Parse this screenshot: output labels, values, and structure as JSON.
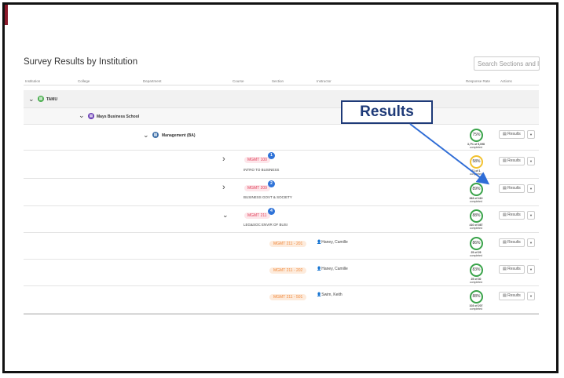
{
  "page": {
    "title": "Survey Results by Institution",
    "search_placeholder": "Search Sections and Insti"
  },
  "columns": {
    "institution": "Institution",
    "college": "College",
    "department": "Department",
    "course": "Course",
    "section": "Section",
    "instructor": "Instructor",
    "response_rate": "Response Rate",
    "actions": "Actions"
  },
  "tree": {
    "institution": "TAMU",
    "college": "Mays Business School",
    "department": "Management (BA)"
  },
  "rates": {
    "mgmt": {
      "pct": "75%",
      "count": "3,7% of 5,098",
      "sub": "completed",
      "value": 0.75
    },
    "c100": {
      "pct": "58%",
      "count": "71 of 1",
      "sub": "completed",
      "value": 0.58
    },
    "c209": {
      "pct": "89%",
      "count": "363 of 410",
      "sub": "completed",
      "value": 0.89
    },
    "c211": {
      "pct": "88%",
      "count": "410 of 467",
      "sub": "completed",
      "value": 0.88
    },
    "s201": {
      "pct": "86%",
      "count": "25 of 29",
      "sub": "completed",
      "value": 0.86
    },
    "s202": {
      "pct": "83%",
      "count": "25 of 30",
      "sub": "completed",
      "value": 0.83
    },
    "s501": {
      "pct": "88%",
      "count": "103 of 207",
      "sub": "completed",
      "value": 0.88
    }
  },
  "courses": {
    "c100": {
      "code": "MGMT 100",
      "name": "INTRO TO BUSINESS",
      "badge": "1"
    },
    "c209": {
      "code": "MGMT 209",
      "name": "BUSINESS GOVT & SOCIETY",
      "badge": "2"
    },
    "c211": {
      "code": "MGMT 211",
      "name": "LEG&SOC ENVIR OF BUSI",
      "badge": "4"
    }
  },
  "sections": {
    "s201": {
      "code": "MGMT 211 - 201",
      "instructor": "Haney, Camille"
    },
    "s202": {
      "code": "MGMT 211 - 202",
      "instructor": "Haney, Camille"
    },
    "s501": {
      "code": "MGMT 211 - 501",
      "instructor": "Swim, Keith"
    }
  },
  "actions": {
    "results_label": "Results",
    "results_icon": "chart-icon",
    "dropdown_icon": "caret-down-icon",
    "chevron_right": "›",
    "chevron_down": "⌄"
  },
  "callout": {
    "label": "Results"
  },
  "colors": {
    "accent_red": "#e0405a",
    "accent_orange": "#f08a3e",
    "badge_blue": "#2f73d8",
    "ring_green": "#3aa34a",
    "ring_yellow": "#f2c230",
    "callout_navy": "#1e3a78",
    "institution_green": "#4caf50",
    "college_purple": "#6a3fb5",
    "department_blue": "#3f70a8"
  }
}
